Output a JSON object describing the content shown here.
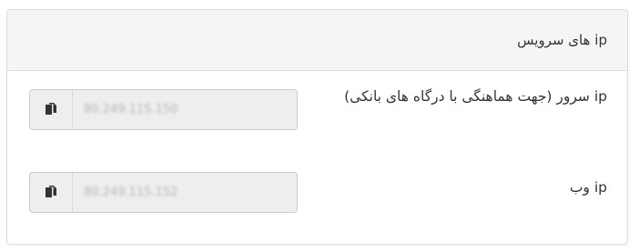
{
  "panel": {
    "title": "ip های سرویس"
  },
  "rows": [
    {
      "label": "ip سرور (جهت هماهنگی با درگاه های بانکی)",
      "value": "80.249.115.150",
      "copy_icon": "copy-icon"
    },
    {
      "label": "ip وب",
      "value": "80.249.115.152",
      "copy_icon": "copy-icon"
    }
  ],
  "colors": {
    "heading_bg": "#f5f5f5",
    "border": "#dddddd",
    "input_bg": "#eeeeee",
    "text": "#333333"
  }
}
